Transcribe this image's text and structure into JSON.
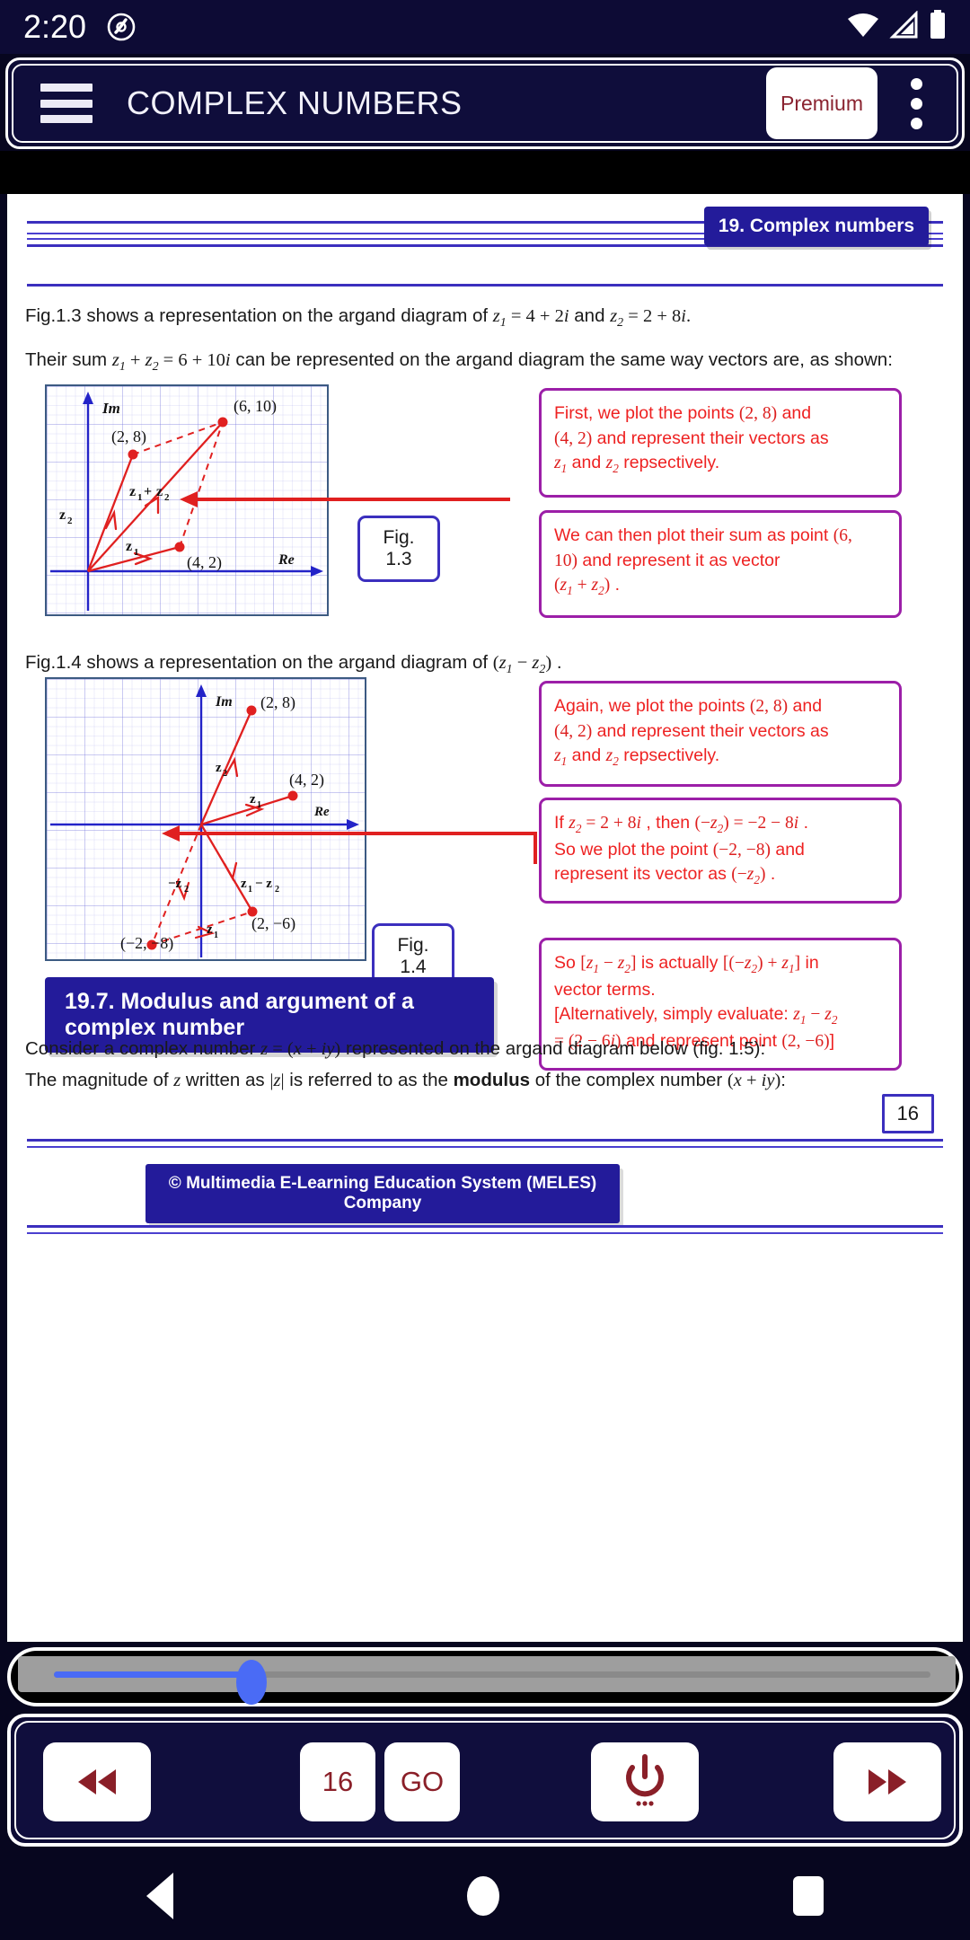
{
  "status_bar": {
    "time": "2:20",
    "app_icon": "capture-icon",
    "wifi_icon": "wifi-icon",
    "signal_icon": "signal-icon",
    "battery_icon": "battery-icon"
  },
  "app_bar": {
    "menu_icon": "hamburger-menu-icon",
    "title": "COMPLEX NUMBERS",
    "premium_label": "Premium",
    "overflow_icon": "kebab-menu-icon"
  },
  "document": {
    "header_chip": "19. Complex numbers",
    "paragraphs": {
      "p1_a": "Fig.1.3 shows a representation on the argand diagram of ",
      "p1_z1": "z",
      "p1_z1_sub": "1",
      "p1_eq1": " = 4 + 2",
      "p1_i1": "i",
      "p1_and": " and  ",
      "p1_z2": "z",
      "p1_z2_sub": "2",
      "p1_eq2": " = 2 + 8",
      "p1_i2": "i",
      "p1_end": ".",
      "p2_a": "Their sum  ",
      "p2_sum": "z",
      "p2_sum_text": " + ",
      "p2_eq": " = 6 + 10",
      "p2_tail": "  can be represented on the argand diagram the same way vectors are, as shown:",
      "p3": "Fig.1.4 shows a representation on the argand diagram of  ",
      "p3_tail": " .",
      "p4_a": "Consider a complex number  ",
      "p4_z": "z",
      "p4_eq": " = (",
      "p4_x": "x",
      "p4_plus": " + ",
      "p4_iy": "iy",
      "p4_close": ")",
      "p4_tail": "  represented on the argand diagram below (fig. 1.5):",
      "p5_a": "The magnitude of  ",
      "p5_z": "z",
      "p5_b": "  written as  |",
      "p5_z2": "z",
      "p5_c": "|  is referred to as the ",
      "p5_bold": "modulus",
      "p5_d": " of the complex number  (",
      "p5_x": "x",
      "p5_e": " + ",
      "p5_iy": "iy",
      "p5_f": "):"
    },
    "fig13": {
      "caption": "Fig. 1.3",
      "axis_im": "Im",
      "axis_re": "Re",
      "point_z1": "(4,  2)",
      "point_z2": "(2,  8)",
      "point_sum": "(6,  10)",
      "label_z1": "z",
      "label_z1_sub": "1",
      "label_z2": "z",
      "label_z2_sub": "2",
      "label_sum": "z₁ + z₂",
      "callout1": {
        "l1_a": "First, we plot the points ",
        "l1_pt": "(2,  8)",
        "l1_b": " and",
        "l2_pt": " (4,  2)",
        "l2_b": " and represent their vectors as",
        "l3_a": "z",
        "l3_sub1": "1",
        "l3_and": " and ",
        "l3_b": "z",
        "l3_sub2": "2",
        "l3_tail": " repsectively."
      },
      "callout2": {
        "l1": "We can then plot their sum as point ",
        "l1_pt": "(6,",
        "l2_pt": "10)",
        "l2": "  and represent it as vector",
        "l3": "(z₁ + z₂) ."
      }
    },
    "fig14": {
      "caption": "Fig. 1.4",
      "axis_im": "Im",
      "axis_re": "Re",
      "point_z2": "(2,  8)",
      "point_z1": "(4,  2)",
      "point_diff": "(2, −6)",
      "point_negz2": "(−2, −8)",
      "label_z1": "z₁",
      "label_z2": "z₂",
      "label_negz2": "−z₂",
      "label_diff": "z₁ − z₂",
      "label_z1b": "z₁",
      "callout1": {
        "l1_a": "Again, we plot the points ",
        "l1_pt": "(2,  8)",
        "l1_b": " and",
        "l2_pt": " (4,  2)",
        "l2_b": " and represent their vectors as",
        "l3_a": "z",
        "l3_sub1": "1",
        "l3_and": " and ",
        "l3_b": "z",
        "l3_sub2": "2",
        "l3_tail": " repsectively."
      },
      "callout2": {
        "l1_a": "If  ",
        "l1_z2": "z₂ = 2 + 8i",
        "l1_b": " , then  ",
        "l1_c": "(−z₂) = −2 − 8i",
        "l1_d": " .",
        "l2_a": "So we plot the point  ",
        "l2_pt": "(−2, −8)",
        "l2_b": " and",
        "l3_a": "represent its vector as  ",
        "l3_b": "(−z₂)",
        "l3_c": " ."
      },
      "callout3": {
        "l1_a": "So  ",
        "l1_b": "[z₁ − z₂]",
        "l1_c": " is actually  ",
        "l1_d": "[(−z₂) + z₁]",
        "l1_e": " in",
        "l2": "vector terms.",
        "l3_a": "[Alternatively, simply evaluate:  ",
        "l3_b": "z₁ − z₂",
        "l4_a": "= (2 − 6i)",
        "l4_b": " and represent point ",
        "l4_c": "(2, −6)",
        "l4_d": "]"
      }
    },
    "section_heading": "19.7. Modulus and argument of a complex number",
    "page_number": "16",
    "copyright": "© Multimedia E-Learning Education System (MELES) Company"
  },
  "seek_bar": {
    "name": "page-seek-slider",
    "fill_percent": 21,
    "fill_color": "#4a6bf5"
  },
  "controls": {
    "rewind_label": "◀◀",
    "page_label": "16",
    "go_label": "GO",
    "power_icon": "power-icon",
    "forward_label": "▶▶"
  },
  "android_nav": {
    "back_icon": "nav-back-icon",
    "home_icon": "nav-home-icon",
    "recents_icon": "nav-recents-icon"
  },
  "colors": {
    "app_bar": "#0f0d3b",
    "accent_blue": "#231b9a",
    "callout_border": "#9c1fa8",
    "callout_text": "#ee2222",
    "vector_red": "#e02020",
    "axis_blue": "#2323c8"
  }
}
